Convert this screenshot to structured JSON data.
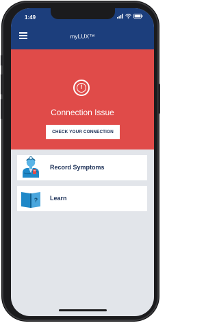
{
  "status_bar": {
    "time": "1:49",
    "icons": [
      "signal-icon",
      "wifi-icon",
      "battery-icon"
    ]
  },
  "app_bar": {
    "title": "myLUX™",
    "menu_icon": "hamburger-menu-icon"
  },
  "alert": {
    "icon": "alert-exclamation-icon",
    "title": "Connection Issue",
    "button_label": "CHECK YOUR CONNECTION",
    "color": "#e04b49"
  },
  "cards": [
    {
      "label": "Record Symptoms",
      "icon": "doctor-icon"
    },
    {
      "label": "Learn",
      "icon": "book-question-icon"
    }
  ],
  "colors": {
    "header": "#1c3e7c",
    "alert_bg": "#e04b49",
    "background": "#e2e5ea",
    "card_text": "#1b2f56",
    "icon_blue": "#1e88c8"
  }
}
